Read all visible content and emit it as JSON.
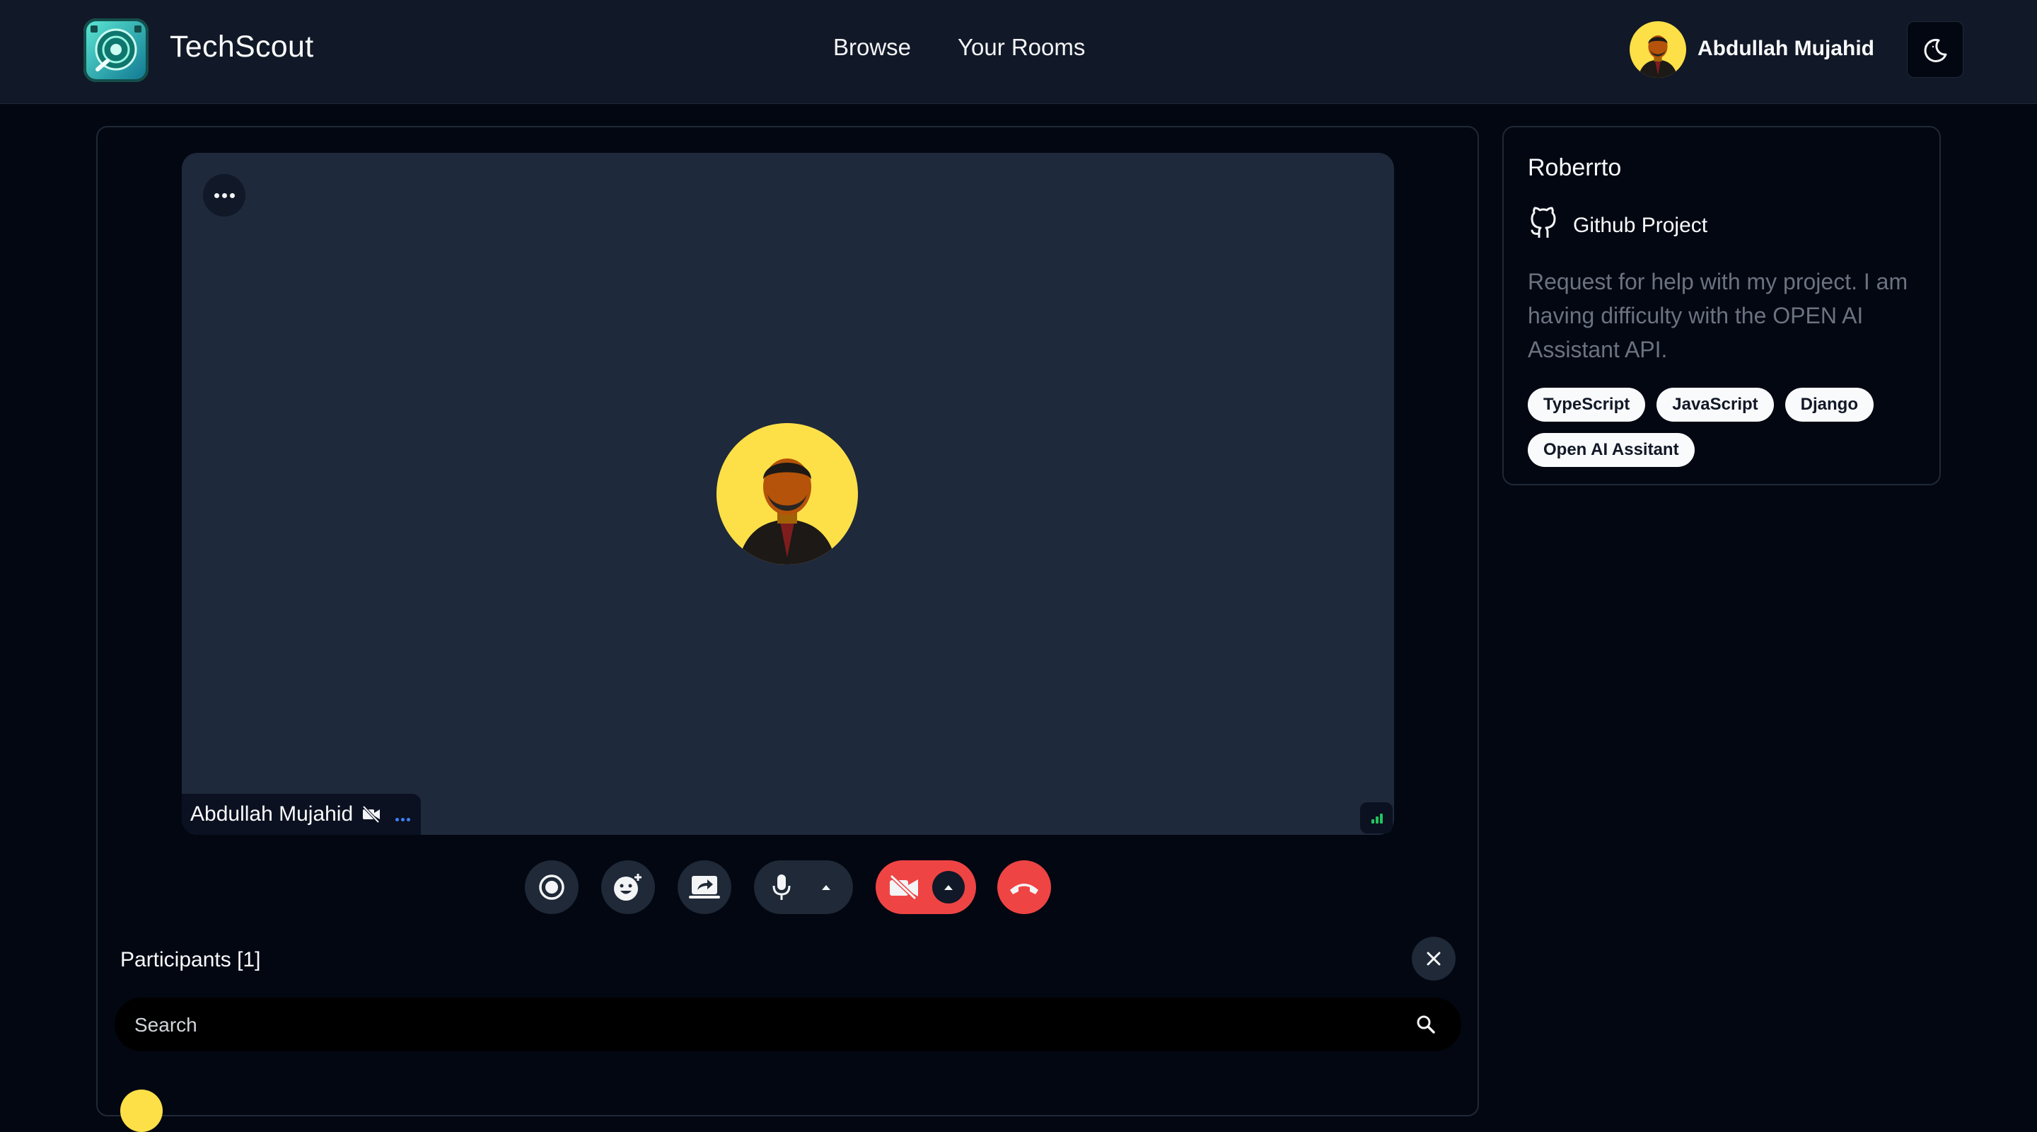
{
  "header": {
    "brand": "TechScout",
    "nav": [
      {
        "label": "Browse"
      },
      {
        "label": "Your Rooms"
      }
    ],
    "user_name": "Abdullah Mujahid"
  },
  "video": {
    "participant_name": "Abdullah Mujahid",
    "avatar_bg": "#fde047"
  },
  "participants": {
    "title": "Participants [1]",
    "search_placeholder": "Search"
  },
  "room": {
    "name": "Roberrto",
    "github_label": "Github Project",
    "description": "Request for help with my project. I am having difficulty with the OPEN AI Assistant API.",
    "tags": [
      "TypeScript",
      "JavaScript",
      "Django",
      "Open AI Assitant"
    ]
  },
  "colors": {
    "background": "#030712",
    "header": "#111827",
    "tile": "#1e293b",
    "danger": "#ef4444",
    "signal": "#22c55e"
  },
  "icons": [
    "logo-icon",
    "theme-toggle-icon",
    "more-icon",
    "camera-off-icon",
    "signal-icon",
    "record-icon",
    "emoji-icon",
    "screen-share-icon",
    "mic-icon",
    "chevron-up-icon",
    "end-call-icon",
    "close-icon",
    "search-icon",
    "github-icon"
  ]
}
